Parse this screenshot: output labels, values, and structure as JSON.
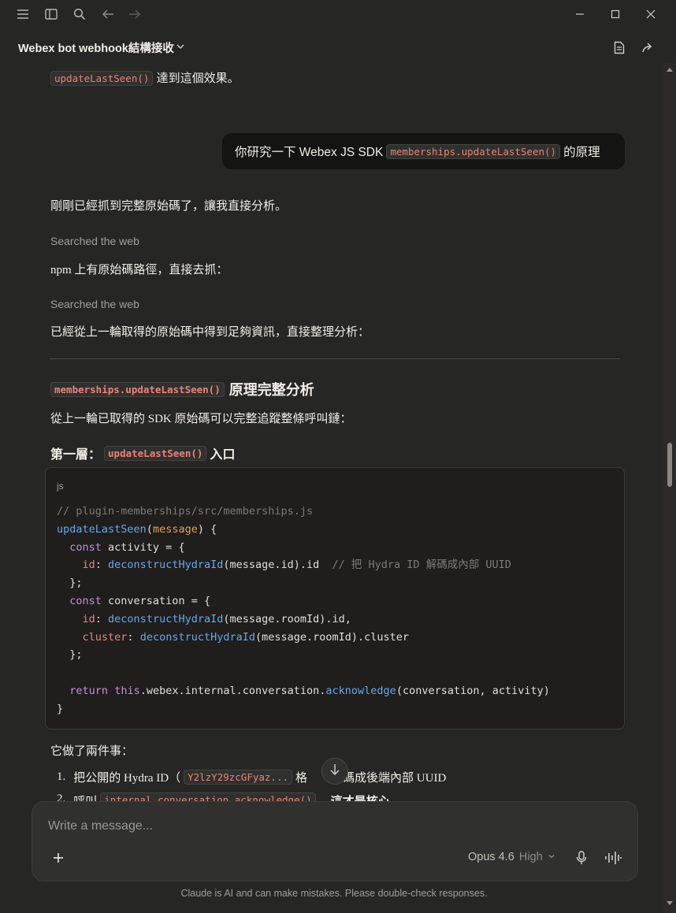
{
  "window": {
    "title": "Webex bot webhook結構接收"
  },
  "messages": {
    "top_fragment_text": "達到這個效果。",
    "top_fragment_code": "updateLastSeen()",
    "user_prefix": "你研究一下 Webex JS SDK",
    "user_code": "memberships.updateLastSeen()",
    "user_suffix": "的原理",
    "reply_intro": "剛剛已經抓到完整原始碼了，讓我直接分析。",
    "status_1": "Searched the web",
    "npm_line": "npm 上有原始碼路徑，直接去抓：",
    "status_2": "Searched the web",
    "enough_line": "已經從上一輪取得的原始碼中得到足夠資訊，直接整理分析：",
    "h2_code": "memberships.updateLastSeen()",
    "h2_text": "原理完整分析",
    "chain_line": "從上一輪已取得的 SDK 原始碼可以完整追蹤整條呼叫鏈：",
    "h3_prefix": "第一層：",
    "h3_code": "updateLastSeen()",
    "h3_suffix": "入口",
    "code_lang": "js",
    "two_things": "它做了兩件事：",
    "list_1_num": "1.",
    "list_1_prefix": "把公開的 Hydra ID（",
    "list_1_code": "Y2lzY29zcGFyaz...",
    "list_1_suffix_a": "格",
    "list_1_suffix_b": "解碼成後端內部 UUID",
    "list_2_num": "2.",
    "list_2_prefix": "呼叫",
    "list_2_code": "internal.conversation.acknowledge()",
    "list_2_suffix": "—這才是核心"
  },
  "composer": {
    "placeholder": "Write a message...",
    "model": "Opus 4.6",
    "effort": "High"
  },
  "footer": {
    "disclaimer": "Claude is AI and can make mistakes. Please double-check responses."
  },
  "icons": {
    "menu": "menu-icon",
    "sidebar": "sidebar-toggle-icon",
    "search": "search-icon",
    "back": "arrow-left-icon",
    "forward": "arrow-right-icon",
    "minimize": "minimize-icon",
    "maximize": "maximize-icon",
    "close": "close-icon",
    "document": "document-icon",
    "share": "share-icon",
    "scroll_down": "arrow-down-icon",
    "add": "plus-icon",
    "mic": "microphone-icon",
    "voice": "voice-waveform-icon"
  }
}
